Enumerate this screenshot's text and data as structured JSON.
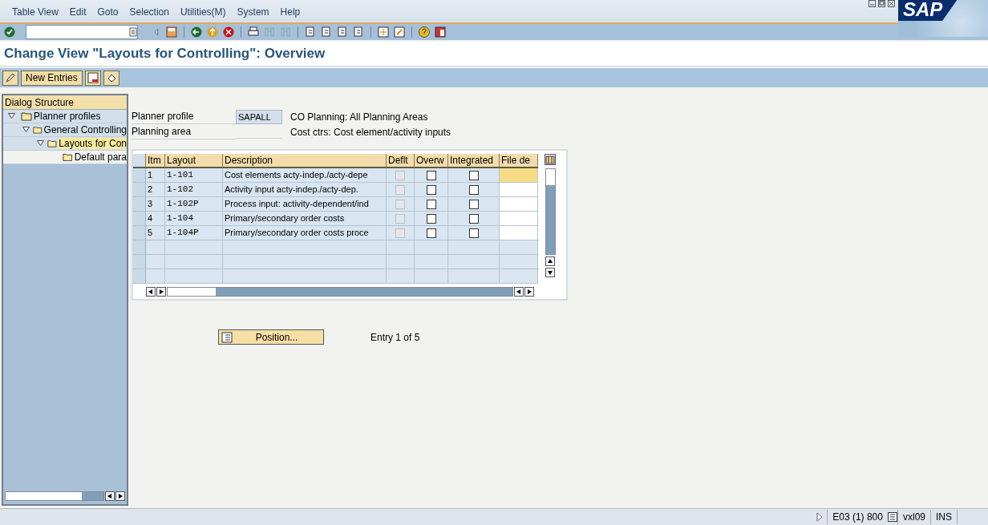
{
  "menu": [
    "Table View",
    "Edit",
    "Goto",
    "Selection",
    "Utilities(M)",
    "System",
    "Help"
  ],
  "logo": "SAP",
  "title": "Change View \"Layouts for Controlling\": Overview",
  "app_toolbar": {
    "new_entries": "New Entries"
  },
  "dialog_structure": {
    "heading": "Dialog Structure",
    "items": [
      {
        "label": "Planner profiles",
        "expanded": true,
        "selected": false,
        "children": [
          {
            "label": "General Controlling",
            "expanded": true,
            "selected": false,
            "children": [
              {
                "label": "Layouts for Con",
                "expanded": true,
                "selected": true,
                "children": [
                  {
                    "label": "Default para",
                    "selected": false
                  }
                ]
              }
            ]
          }
        ]
      }
    ]
  },
  "fields": [
    {
      "label": "Planner profile",
      "value": "SAPALL",
      "description": "CO Planning: All Planning Areas"
    },
    {
      "label": "Planning area",
      "description": "Cost ctrs: Cost element/activity inputs"
    }
  ],
  "table": {
    "columns": [
      "Itm",
      "Layout",
      "Description",
      "Deflt",
      "Overw",
      "Integrated",
      "File de"
    ],
    "rows": [
      {
        "itm": "1",
        "layout": "1-101",
        "description": "Cost elements acty-indep./acty-depe",
        "deflt": {
          "checked": false,
          "disabled": true
        },
        "overw": false,
        "integrated": false,
        "file_selected": true
      },
      {
        "itm": "2",
        "layout": "1-102",
        "description": "Activity input acty-indep./acty-dep.",
        "deflt": {
          "checked": false,
          "disabled": true
        },
        "overw": false,
        "integrated": false,
        "file_selected": false
      },
      {
        "itm": "3",
        "layout": "1-102P",
        "description": "Process input: activity-dependent/ind",
        "deflt": {
          "checked": false,
          "disabled": true
        },
        "overw": false,
        "integrated": false,
        "file_selected": false
      },
      {
        "itm": "4",
        "layout": "1-104",
        "description": "Primary/secondary order costs",
        "deflt": {
          "checked": false,
          "disabled": true
        },
        "overw": false,
        "integrated": false,
        "file_selected": false
      },
      {
        "itm": "5",
        "layout": "1-104P",
        "description": "Primary/secondary order costs proce",
        "deflt": {
          "checked": false,
          "disabled": true
        },
        "overw": false,
        "integrated": false,
        "file_selected": false
      }
    ]
  },
  "position_button": "Position...",
  "entry_info": "Entry 1 of 5",
  "status_bar": {
    "system": "E03 (1) 800",
    "server": "vxl09",
    "mode": "INS"
  }
}
